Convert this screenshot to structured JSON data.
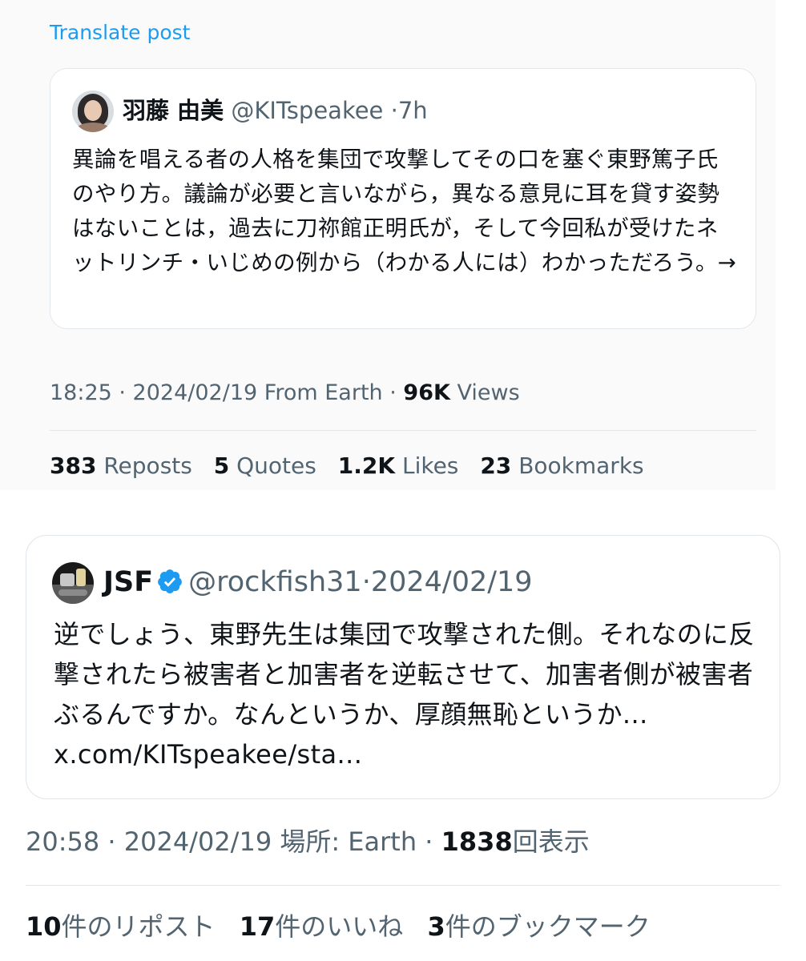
{
  "quoted_post": {
    "translate_label": "Translate post",
    "card": {
      "author_name": "羽藤 由美",
      "handle": "@KITspeakee",
      "separator": "·",
      "age": "7h",
      "text": "異論を唱える者の人格を集団で攻撃してその口を塞ぐ東野篤子氏のやり方。議論が必要と言いながら，異なる意見に耳を貸す姿勢はないことは，過去に刀祢館正明氏が，そして今回私が受けたネットリンチ・いじめの例から（わかる人には）わかっただろう。→"
    },
    "meta": {
      "time": "18:25 · 2024/02/19 From Earth ·",
      "views_count": "96K",
      "views_label": "Views"
    },
    "stats": [
      {
        "count": "383",
        "label": "Reposts"
      },
      {
        "count": "5",
        "label": "Quotes"
      },
      {
        "count": "1.2K",
        "label": "Likes"
      },
      {
        "count": "23",
        "label": "Bookmarks"
      }
    ]
  },
  "reply_post": {
    "card": {
      "author_name": "JSF",
      "verified_icon": "verified-badge-icon",
      "handle": "@rockfish31",
      "separator": "·",
      "date": "2024/02/19",
      "text": "逆でしょう、東野先生は集団で攻撃された側。それなのに反撃されたら被害者と加害者を逆転させて、加害者側が被害者ぶるんですか。なんというか、厚顔無恥というか... x.com/KITspeakee/sta..."
    },
    "meta": {
      "time": "20:58 · 2024/02/19 場所: Earth ·",
      "views_count": "1838",
      "views_label": "回表示"
    },
    "stats": [
      {
        "count": "10",
        "label": "件のリポスト"
      },
      {
        "count": "17",
        "label": "件のいいね"
      },
      {
        "count": "3",
        "label": "件のブックマーク"
      }
    ]
  },
  "colors": {
    "link_blue": "#1d9bf0",
    "text_primary": "#0f1419",
    "text_secondary": "#536471",
    "border": "#e1e8ed"
  }
}
